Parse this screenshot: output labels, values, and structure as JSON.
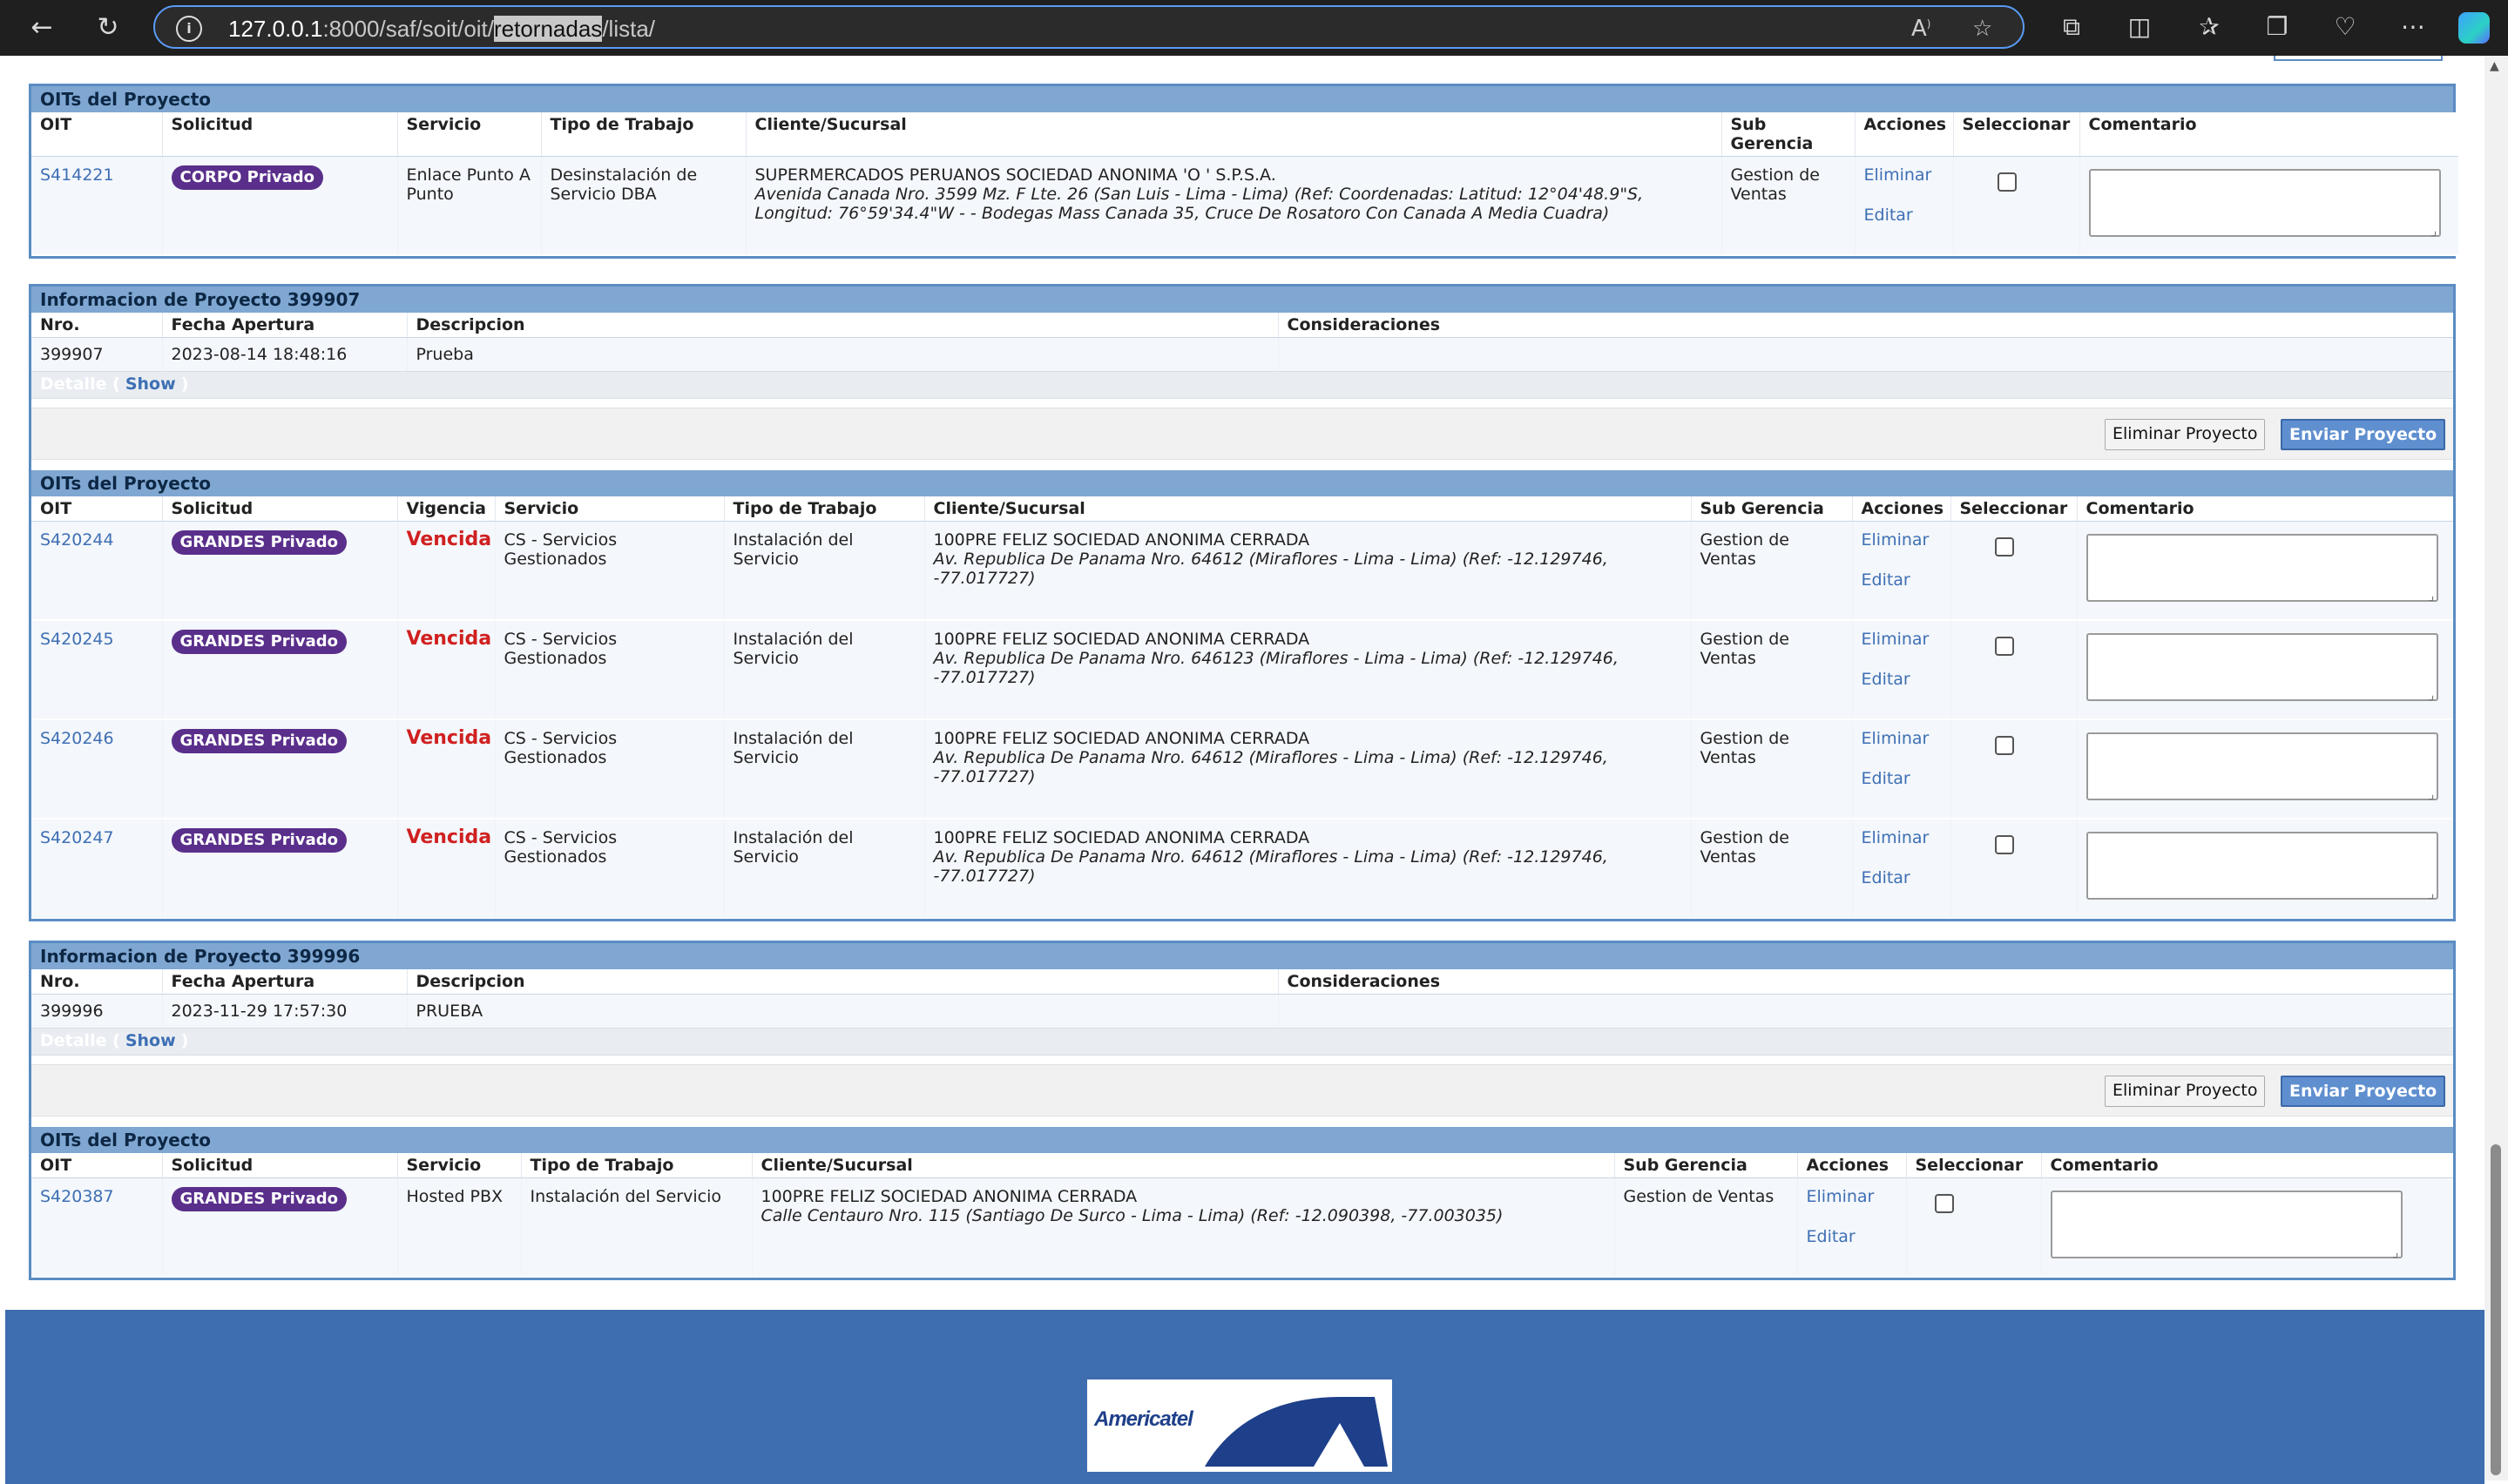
{
  "browser": {
    "url_host": "127.0.0.1",
    "url_pre": ":8000/saf/soit/oit/",
    "url_highlight": "retornadas",
    "url_post": "/lista/"
  },
  "section_titles": {
    "oits": "OITs del Proyecto",
    "eliminar": "Eliminar",
    "editar": "Editar",
    "detalle": "Detalle (",
    "show": "Show",
    "detalle_close": ")",
    "eliminar_proyecto": "Eliminar Proyecto",
    "enviar_proyecto": "Enviar Proyecto"
  },
  "oit_headers_a": {
    "oit": "OIT",
    "solicitud": "Solicitud",
    "servicio": "Servicio",
    "tipo": "Tipo de Trabajo",
    "cliente": "Cliente/Sucursal",
    "sub": "Sub Gerencia",
    "acciones": "Acciones",
    "seleccionar": "Seleccionar",
    "comentario": "Comentario"
  },
  "oit_headers_b": {
    "oit": "OIT",
    "solicitud": "Solicitud",
    "vigencia": "Vigencia",
    "servicio": "Servicio",
    "tipo": "Tipo de Trabajo",
    "cliente": "Cliente/Sucursal",
    "sub": "Sub Gerencia",
    "acciones": "Acciones",
    "seleccionar": "Seleccionar",
    "comentario": "Comentario"
  },
  "info_headers": {
    "nro": "Nro.",
    "fecha": "Fecha Apertura",
    "descripcion": "Descripcion",
    "consideraciones": "Consideraciones"
  },
  "block1": {
    "rows": [
      {
        "oit": "S414221",
        "solicitud": "CORPO Privado",
        "servicio": "Enlace Punto A Punto",
        "tipo": "Desinstalación de Servicio DBA",
        "cliente": "SUPERMERCADOS PERUANOS SOCIEDAD ANONIMA 'O ' S.P.S.A.",
        "direccion": "Avenida Canada Nro. 3599 Mz. F Lte. 26 (San Luis - Lima - Lima) (Ref: Coordenadas: Latitud: 12°04'48.9\"S, Longitud: 76°59'34.4\"W - - Bodegas Mass Canada 35, Cruce De Rosatoro Con Canada A Media Cuadra)",
        "sub": "Gestion de Ventas"
      }
    ]
  },
  "project2": {
    "title": "Informacion de Proyecto 399907",
    "nro": "399907",
    "fecha": "2023-08-14 18:48:16",
    "descripcion": "Prueba",
    "consideraciones": "",
    "rows": [
      {
        "oit": "S420244",
        "solicitud": "GRANDES Privado",
        "vigencia": "Vencida",
        "servicio": "CS - Servicios Gestionados",
        "tipo": "Instalación del Servicio",
        "cliente": "100PRE FELIZ SOCIEDAD ANONIMA CERRADA",
        "direccion": "Av. Republica De Panama Nro. 64612 (Miraflores - Lima - Lima) (Ref: -12.129746, -77.017727)",
        "sub": "Gestion de Ventas"
      },
      {
        "oit": "S420245",
        "solicitud": "GRANDES Privado",
        "vigencia": "Vencida",
        "servicio": "CS - Servicios Gestionados",
        "tipo": "Instalación del Servicio",
        "cliente": "100PRE FELIZ SOCIEDAD ANONIMA CERRADA",
        "direccion": "Av. Republica De Panama Nro. 646123 (Miraflores - Lima - Lima) (Ref: -12.129746, -77.017727)",
        "sub": "Gestion de Ventas"
      },
      {
        "oit": "S420246",
        "solicitud": "GRANDES Privado",
        "vigencia": "Vencida",
        "servicio": "CS - Servicios Gestionados",
        "tipo": "Instalación del Servicio",
        "cliente": "100PRE FELIZ SOCIEDAD ANONIMA CERRADA",
        "direccion": "Av. Republica De Panama Nro. 64612 (Miraflores - Lima - Lima) (Ref: -12.129746, -77.017727)",
        "sub": "Gestion de Ventas"
      },
      {
        "oit": "S420247",
        "solicitud": "GRANDES Privado",
        "vigencia": "Vencida",
        "servicio": "CS - Servicios Gestionados",
        "tipo": "Instalación del Servicio",
        "cliente": "100PRE FELIZ SOCIEDAD ANONIMA CERRADA",
        "direccion": "Av. Republica De Panama Nro. 64612 (Miraflores - Lima - Lima) (Ref: -12.129746, -77.017727)",
        "sub": "Gestion de Ventas"
      }
    ]
  },
  "project3": {
    "title": "Informacion de Proyecto 399996",
    "nro": "399996",
    "fecha": "2023-11-29 17:57:30",
    "descripcion": "PRUEBA",
    "consideraciones": "",
    "rows": [
      {
        "oit": "S420387",
        "solicitud": "GRANDES Privado",
        "servicio": "Hosted PBX",
        "tipo": "Instalación del Servicio",
        "cliente": "100PRE FELIZ SOCIEDAD ANONIMA CERRADA",
        "direccion": "Calle Centauro Nro. 115 (Santiago De Surco - Lima - Lima) (Ref: -12.090398, -77.003035)",
        "sub": "Gestion de Ventas"
      }
    ]
  },
  "footer": {
    "logo_text": "Americatel"
  },
  "colors": {
    "header_blue": "#7fa7d2",
    "badge_purple": "#5a2f8b",
    "vencida_red": "#d02020",
    "footer_blue": "#3e6db0"
  }
}
